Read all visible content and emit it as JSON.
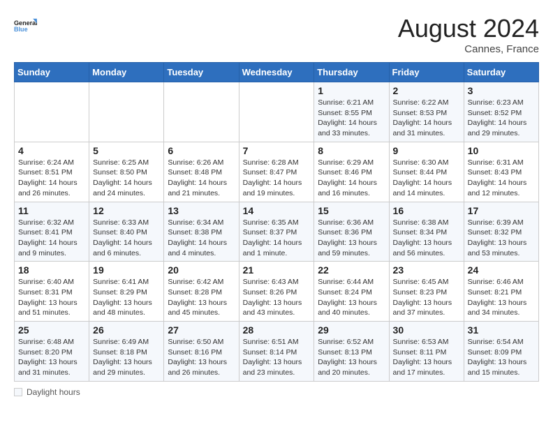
{
  "header": {
    "logo_line1": "General",
    "logo_line2": "Blue",
    "month_year": "August 2024",
    "location": "Cannes, France"
  },
  "days_of_week": [
    "Sunday",
    "Monday",
    "Tuesday",
    "Wednesday",
    "Thursday",
    "Friday",
    "Saturday"
  ],
  "weeks": [
    [
      {
        "num": "",
        "info": ""
      },
      {
        "num": "",
        "info": ""
      },
      {
        "num": "",
        "info": ""
      },
      {
        "num": "",
        "info": ""
      },
      {
        "num": "1",
        "info": "Sunrise: 6:21 AM\nSunset: 8:55 PM\nDaylight: 14 hours and 33 minutes."
      },
      {
        "num": "2",
        "info": "Sunrise: 6:22 AM\nSunset: 8:53 PM\nDaylight: 14 hours and 31 minutes."
      },
      {
        "num": "3",
        "info": "Sunrise: 6:23 AM\nSunset: 8:52 PM\nDaylight: 14 hours and 29 minutes."
      }
    ],
    [
      {
        "num": "4",
        "info": "Sunrise: 6:24 AM\nSunset: 8:51 PM\nDaylight: 14 hours and 26 minutes."
      },
      {
        "num": "5",
        "info": "Sunrise: 6:25 AM\nSunset: 8:50 PM\nDaylight: 14 hours and 24 minutes."
      },
      {
        "num": "6",
        "info": "Sunrise: 6:26 AM\nSunset: 8:48 PM\nDaylight: 14 hours and 21 minutes."
      },
      {
        "num": "7",
        "info": "Sunrise: 6:28 AM\nSunset: 8:47 PM\nDaylight: 14 hours and 19 minutes."
      },
      {
        "num": "8",
        "info": "Sunrise: 6:29 AM\nSunset: 8:46 PM\nDaylight: 14 hours and 16 minutes."
      },
      {
        "num": "9",
        "info": "Sunrise: 6:30 AM\nSunset: 8:44 PM\nDaylight: 14 hours and 14 minutes."
      },
      {
        "num": "10",
        "info": "Sunrise: 6:31 AM\nSunset: 8:43 PM\nDaylight: 14 hours and 12 minutes."
      }
    ],
    [
      {
        "num": "11",
        "info": "Sunrise: 6:32 AM\nSunset: 8:41 PM\nDaylight: 14 hours and 9 minutes."
      },
      {
        "num": "12",
        "info": "Sunrise: 6:33 AM\nSunset: 8:40 PM\nDaylight: 14 hours and 6 minutes."
      },
      {
        "num": "13",
        "info": "Sunrise: 6:34 AM\nSunset: 8:38 PM\nDaylight: 14 hours and 4 minutes."
      },
      {
        "num": "14",
        "info": "Sunrise: 6:35 AM\nSunset: 8:37 PM\nDaylight: 14 hours and 1 minute."
      },
      {
        "num": "15",
        "info": "Sunrise: 6:36 AM\nSunset: 8:36 PM\nDaylight: 13 hours and 59 minutes."
      },
      {
        "num": "16",
        "info": "Sunrise: 6:38 AM\nSunset: 8:34 PM\nDaylight: 13 hours and 56 minutes."
      },
      {
        "num": "17",
        "info": "Sunrise: 6:39 AM\nSunset: 8:32 PM\nDaylight: 13 hours and 53 minutes."
      }
    ],
    [
      {
        "num": "18",
        "info": "Sunrise: 6:40 AM\nSunset: 8:31 PM\nDaylight: 13 hours and 51 minutes."
      },
      {
        "num": "19",
        "info": "Sunrise: 6:41 AM\nSunset: 8:29 PM\nDaylight: 13 hours and 48 minutes."
      },
      {
        "num": "20",
        "info": "Sunrise: 6:42 AM\nSunset: 8:28 PM\nDaylight: 13 hours and 45 minutes."
      },
      {
        "num": "21",
        "info": "Sunrise: 6:43 AM\nSunset: 8:26 PM\nDaylight: 13 hours and 43 minutes."
      },
      {
        "num": "22",
        "info": "Sunrise: 6:44 AM\nSunset: 8:24 PM\nDaylight: 13 hours and 40 minutes."
      },
      {
        "num": "23",
        "info": "Sunrise: 6:45 AM\nSunset: 8:23 PM\nDaylight: 13 hours and 37 minutes."
      },
      {
        "num": "24",
        "info": "Sunrise: 6:46 AM\nSunset: 8:21 PM\nDaylight: 13 hours and 34 minutes."
      }
    ],
    [
      {
        "num": "25",
        "info": "Sunrise: 6:48 AM\nSunset: 8:20 PM\nDaylight: 13 hours and 31 minutes."
      },
      {
        "num": "26",
        "info": "Sunrise: 6:49 AM\nSunset: 8:18 PM\nDaylight: 13 hours and 29 minutes."
      },
      {
        "num": "27",
        "info": "Sunrise: 6:50 AM\nSunset: 8:16 PM\nDaylight: 13 hours and 26 minutes."
      },
      {
        "num": "28",
        "info": "Sunrise: 6:51 AM\nSunset: 8:14 PM\nDaylight: 13 hours and 23 minutes."
      },
      {
        "num": "29",
        "info": "Sunrise: 6:52 AM\nSunset: 8:13 PM\nDaylight: 13 hours and 20 minutes."
      },
      {
        "num": "30",
        "info": "Sunrise: 6:53 AM\nSunset: 8:11 PM\nDaylight: 13 hours and 17 minutes."
      },
      {
        "num": "31",
        "info": "Sunrise: 6:54 AM\nSunset: 8:09 PM\nDaylight: 13 hours and 15 minutes."
      }
    ]
  ],
  "footer": {
    "label": "Daylight hours"
  }
}
